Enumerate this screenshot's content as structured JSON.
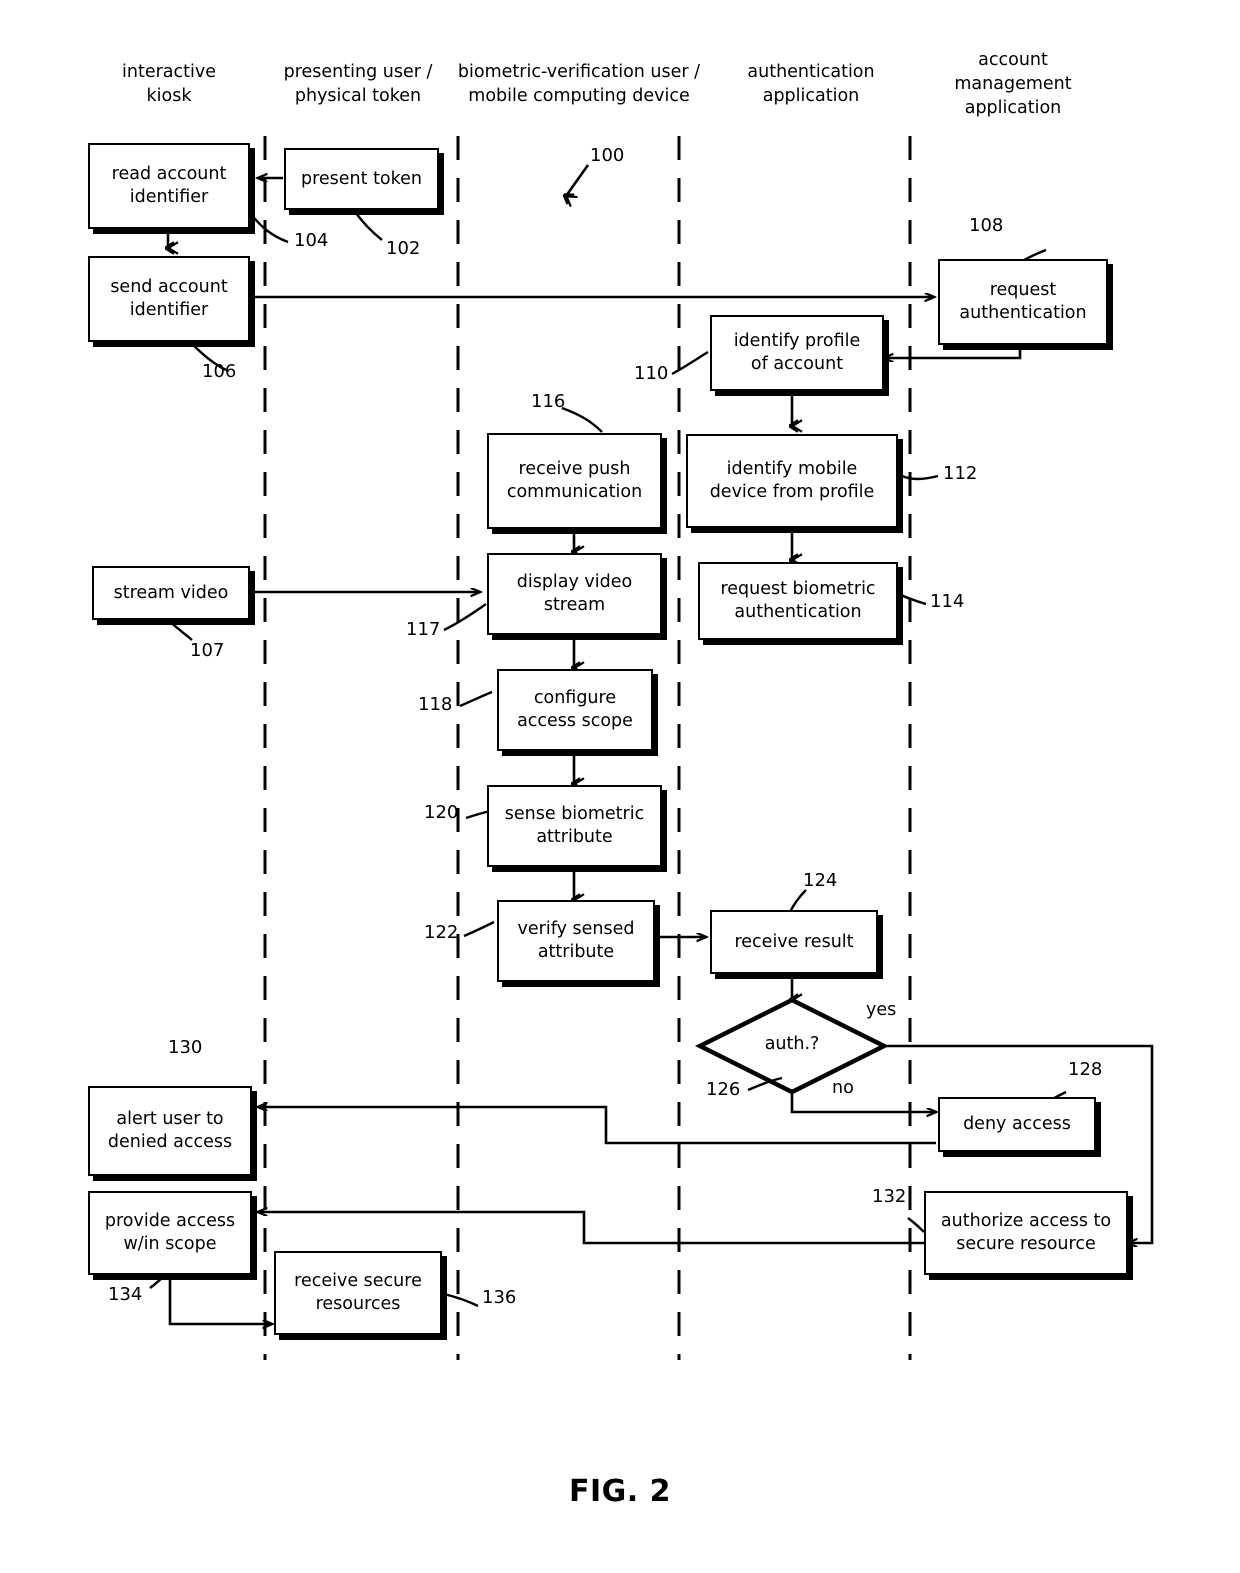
{
  "figure": {
    "caption": "FIG. 2",
    "diagram_ref": "100",
    "type": "swimlane-flowchart"
  },
  "lanes": [
    {
      "id": "kiosk",
      "title": "interactive\nkiosk"
    },
    {
      "id": "presenting-user",
      "title": "presenting user /\nphysical token"
    },
    {
      "id": "biometric-user",
      "title": "biometric-verification user /\nmobile computing device"
    },
    {
      "id": "auth-app",
      "title": "authentication\napplication"
    },
    {
      "id": "account-mgmt",
      "title": "account\nmanagement\napplication"
    }
  ],
  "nodes": [
    {
      "id": "n104",
      "ref": "104",
      "label": "read account\nidentifier",
      "lane": "kiosk"
    },
    {
      "id": "n102",
      "ref": "102",
      "label": "present token",
      "lane": "presenting-user"
    },
    {
      "id": "n106",
      "ref": "106",
      "label": "send account\nidentifier",
      "lane": "kiosk"
    },
    {
      "id": "n108",
      "ref": "108",
      "label": "request\nauthentication",
      "lane": "account-mgmt"
    },
    {
      "id": "n110",
      "ref": "110",
      "label": "identify profile\nof account",
      "lane": "auth-app"
    },
    {
      "id": "n116",
      "ref": "116",
      "label": "receive push\ncommunication",
      "lane": "biometric-user"
    },
    {
      "id": "n112",
      "ref": "112",
      "label": "identify mobile\ndevice from profile",
      "lane": "auth-app"
    },
    {
      "id": "n107",
      "ref": "107",
      "label": "stream video",
      "lane": "kiosk"
    },
    {
      "id": "n117",
      "ref": "117",
      "label": "display video\nstream",
      "lane": "biometric-user"
    },
    {
      "id": "n114",
      "ref": "114",
      "label": "request biometric\nauthentication",
      "lane": "auth-app"
    },
    {
      "id": "n118",
      "ref": "118",
      "label": "configure\naccess scope",
      "lane": "biometric-user"
    },
    {
      "id": "n120",
      "ref": "120",
      "label": "sense biometric\nattribute",
      "lane": "biometric-user"
    },
    {
      "id": "n122",
      "ref": "122",
      "label": "verify sensed\nattribute",
      "lane": "biometric-user"
    },
    {
      "id": "n124",
      "ref": "124",
      "label": "receive result",
      "lane": "auth-app"
    },
    {
      "id": "n126",
      "ref": "126",
      "label": "auth.?",
      "lane": "auth-app",
      "shape": "decision"
    },
    {
      "id": "n128",
      "ref": "128",
      "label": "deny access",
      "lane": "account-mgmt"
    },
    {
      "id": "n130",
      "ref": "130",
      "label": "alert user to\ndenied access",
      "lane": "kiosk"
    },
    {
      "id": "n132",
      "ref": "132",
      "label": "authorize access to\nsecure resource",
      "lane": "account-mgmt"
    },
    {
      "id": "n134",
      "ref": "134",
      "label": "provide access\nw/in scope",
      "lane": "kiosk"
    },
    {
      "id": "n136",
      "ref": "136",
      "label": "receive secure\nresources",
      "lane": "presenting-user"
    }
  ],
  "edge_labels": {
    "yes": "yes",
    "no": "no"
  },
  "colors": {
    "stroke": "#000000",
    "background": "#ffffff"
  }
}
